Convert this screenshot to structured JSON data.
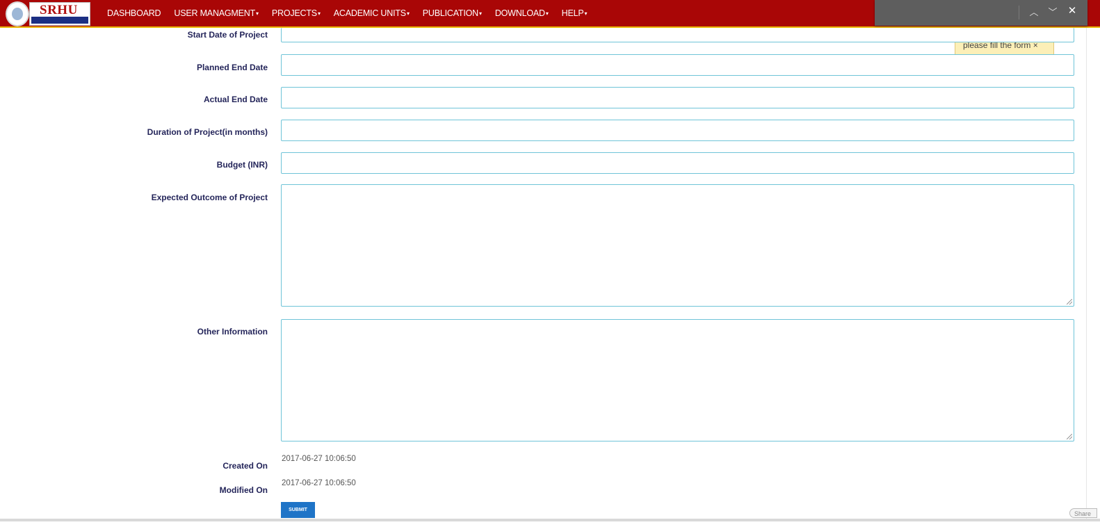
{
  "logo": {
    "text": "SRHU"
  },
  "nav": {
    "items": [
      {
        "label": "DASHBOARD",
        "caret": ""
      },
      {
        "label": "USER MANAGMENT",
        "caret": "▾"
      },
      {
        "label": "PROJECTS",
        "caret": "▾"
      },
      {
        "label": "ACADEMIC UNITS",
        "caret": "▾"
      },
      {
        "label": "PUBLICATION",
        "caret": "▾"
      },
      {
        "label": "DOWNLOAD",
        "caret": "▾"
      },
      {
        "label": "HELP",
        "caret": "▾"
      }
    ]
  },
  "findbar": {
    "up_icon": "chevron-up-icon",
    "down_icon": "chevron-down-icon",
    "close_icon": "close-icon",
    "up_glyph": "︿",
    "down_glyph": "﹀",
    "close_glyph": "✕"
  },
  "toast": {
    "message": "please fill the form ×"
  },
  "form": {
    "start_date_label": "Start Date of Project",
    "planned_end_label": "Planned End Date",
    "actual_end_label": "Actual End Date",
    "duration_label": "Duration of Project(in months)",
    "budget_label": "Budget (INR)",
    "outcome_label": "Expected Outcome of Project",
    "other_label": "Other Information",
    "created_label": "Created On",
    "created_value": "2017-06-27 10:06:50",
    "modified_label": "Modified On",
    "modified_value": "2017-06-27 10:06:50",
    "submit_label": "SUBMIT"
  },
  "share": {
    "label": "Share"
  },
  "colors": {
    "navbar": "#a90606",
    "navbar_border": "#e9b400",
    "label": "#24255a",
    "field_border": "#6fc4d8",
    "submit": "#1f74c7",
    "toast_bg": "#fcefb7"
  }
}
